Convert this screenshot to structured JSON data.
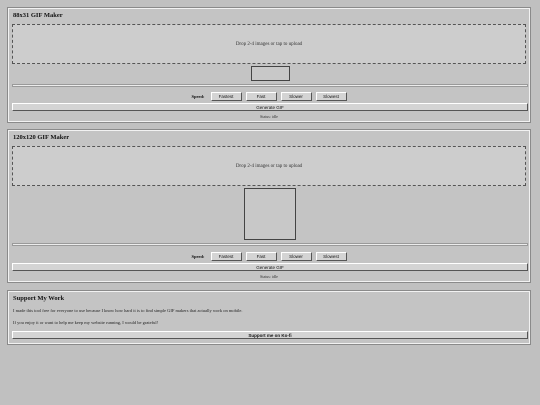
{
  "maker_small": {
    "title": "88x31 GIF Maker",
    "drop_text": "Drop 2-4 images or tap to upload",
    "speed_label": "Speed:",
    "speeds": [
      "Fastest",
      "Fast",
      "Slower",
      "Slowest"
    ],
    "generate_label": "Generate GIF",
    "status": "Status: idle"
  },
  "maker_large": {
    "title": "120x120 GIF Maker",
    "drop_text": "Drop 2-4 images or tap to upload",
    "speed_label": "Speed:",
    "speeds": [
      "Fastest",
      "Fast",
      "Slower",
      "Slowest"
    ],
    "generate_label": "Generate GIF",
    "status": "Status: idle"
  },
  "support": {
    "title": "Support My Work",
    "paragraph1": "I made this tool free for everyone to use because I know how hard it is to find simple GIF makers that actually work on mobile.",
    "paragraph2": "If you enjoy it or want to help me keep my website running, I would be grateful!",
    "button_label": "Support me on Ko-fi"
  }
}
